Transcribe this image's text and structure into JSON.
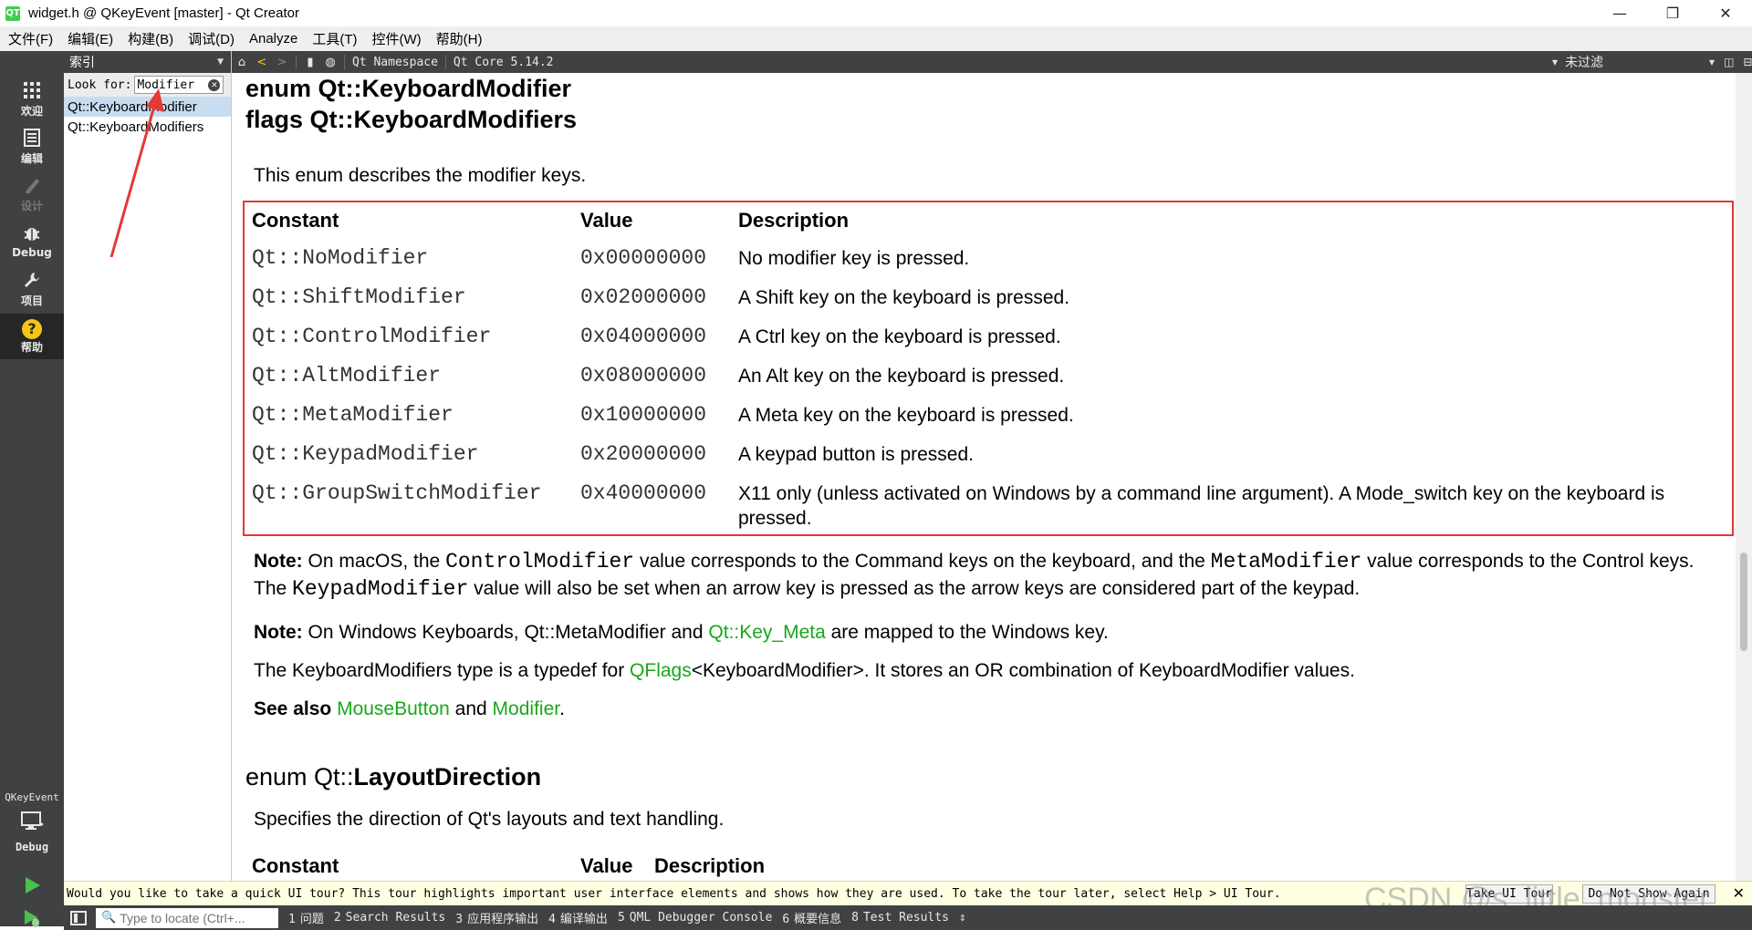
{
  "window": {
    "title": "widget.h @ QKeyEvent [master] - Qt Creator",
    "app_icon": "QT",
    "controls": {
      "minimize": "—",
      "maximize": "❐",
      "close": "✕"
    }
  },
  "menu": [
    "文件(F)",
    "编辑(E)",
    "构建(B)",
    "调试(D)",
    "Analyze",
    "工具(T)",
    "控件(W)",
    "帮助(H)"
  ],
  "modes": {
    "welcome": {
      "icon": "grid-icon",
      "label": "欢迎"
    },
    "edit": {
      "icon": "document-icon",
      "label": "编辑"
    },
    "design": {
      "icon": "pencil-icon",
      "label": "设计"
    },
    "debug": {
      "icon": "bug-icon",
      "label": "Debug"
    },
    "projects": {
      "icon": "wrench-icon",
      "label": "项目"
    },
    "help": {
      "icon": "question-icon",
      "label": "帮助"
    }
  },
  "build": {
    "project": "QKeyEvent",
    "target_label": "Debug",
    "run_icon": "run-icon",
    "debug_run_icon": "debug-run-icon",
    "build_icon": "hammer-icon"
  },
  "index_pane": {
    "title": "索引",
    "look_for_label": "Look for:",
    "look_for_value": "Modifier",
    "items": [
      "Qt::KeyboardModifier",
      "Qt::KeyboardModifiers"
    ]
  },
  "help_toolbar": {
    "breadcrumbs": [
      "Qt Namespace",
      "Qt Core 5.14.2"
    ],
    "filter": "未过滤"
  },
  "doc": {
    "heading1": "enum Qt::KeyboardModifier",
    "heading2": "flags Qt::KeyboardModifiers",
    "intro": "This enum describes the modifier keys.",
    "table_headers": [
      "Constant",
      "Value",
      "Description"
    ],
    "rows": [
      {
        "constant": "Qt::NoModifier",
        "value": "0x00000000",
        "description": "No modifier key is pressed."
      },
      {
        "constant": "Qt::ShiftModifier",
        "value": "0x02000000",
        "description": "A Shift key on the keyboard is pressed."
      },
      {
        "constant": "Qt::ControlModifier",
        "value": "0x04000000",
        "description": "A Ctrl key on the keyboard is pressed."
      },
      {
        "constant": "Qt::AltModifier",
        "value": "0x08000000",
        "description": "An Alt key on the keyboard is pressed."
      },
      {
        "constant": "Qt::MetaModifier",
        "value": "0x10000000",
        "description": "A Meta key on the keyboard is pressed."
      },
      {
        "constant": "Qt::KeypadModifier",
        "value": "0x20000000",
        "description": "A keypad button is pressed."
      },
      {
        "constant": "Qt::GroupSwitchModifier",
        "value": "0x40000000",
        "description": "X11 only (unless activated on Windows by a command line argument). A Mode_switch key on the keyboard is pressed."
      }
    ],
    "note1": {
      "label": "Note:",
      "t1": " On macOS, the ",
      "c1": "ControlModifier",
      "t2": " value corresponds to the Command keys on the keyboard, and the ",
      "c2": "MetaModifier",
      "t3": " value corresponds to the Control keys. The ",
      "c3": "KeypadModifier",
      "t4": " value will also be set when an arrow key is pressed as the arrow keys are considered part of the keypad."
    },
    "note2": {
      "label": "Note:",
      "t1": " On Windows Keyboards, Qt::MetaModifier and ",
      "link": "Qt::Key_Meta",
      "t2": " are mapped to the Windows key."
    },
    "typedef": {
      "t1": "The KeyboardModifiers type is a typedef for ",
      "link": "QFlags",
      "t2": "<KeyboardModifier>. It stores an OR combination of KeyboardModifier values."
    },
    "see_also": {
      "label": "See also",
      "link1": "MouseButton",
      "and": " and ",
      "link2": "Modifier",
      "end": "."
    },
    "layout_heading_prefix": "enum Qt::",
    "layout_heading_name": "LayoutDirection",
    "layout_intro": "Specifies the direction of Qt's layouts and text handling.",
    "layout_headers": [
      "Constant",
      "Value",
      "Description"
    ]
  },
  "notification": {
    "text": "Would you like to take a quick UI tour? This tour highlights important user interface elements and shows how they are used. To take the tour later, select Help > UI Tour.",
    "take_tour": "Take UI Tour",
    "do_not_show": "Do Not Show Again",
    "close": "✕"
  },
  "watermark": "CSDN @s_little_monster",
  "statusbar": {
    "locate_placeholder": "Type to locate (Ctrl+...",
    "tabs": [
      {
        "num": "1",
        "label": "问题"
      },
      {
        "num": "2",
        "label": "Search Results"
      },
      {
        "num": "3",
        "label": "应用程序输出"
      },
      {
        "num": "4",
        "label": "编译输出"
      },
      {
        "num": "5",
        "label": "QML Debugger Console"
      },
      {
        "num": "6",
        "label": "概要信息"
      },
      {
        "num": "8",
        "label": "Test Results"
      }
    ],
    "more": "⇕"
  },
  "colors": {
    "link": "#17a81a",
    "highlight_box": "#e53935",
    "sidebar": "#404142",
    "notify_bg": "#ffffe1"
  }
}
